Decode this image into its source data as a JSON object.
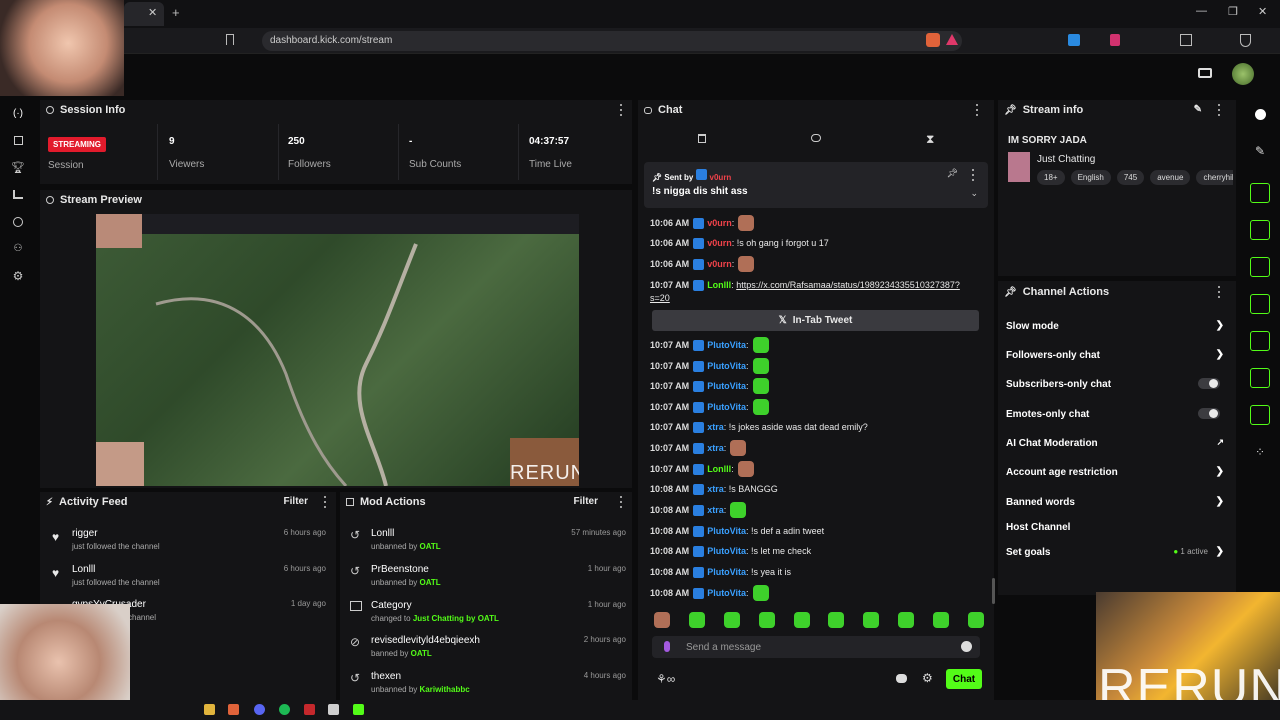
{
  "browser": {
    "url": "dashboard.kick.com/stream"
  },
  "session_info": {
    "title": "Session Info",
    "status": "STREAMING",
    "session_label": "Session",
    "stats": [
      {
        "value": "9",
        "label": "Viewers"
      },
      {
        "value": "250",
        "label": "Followers"
      },
      {
        "value": "-",
        "label": "Sub Counts"
      },
      {
        "value": "04:37:57",
        "label": "Time Live"
      }
    ]
  },
  "stream_preview": {
    "title": "Stream Preview",
    "overlay_text": "RERUN"
  },
  "activity_feed": {
    "title": "Activity Feed",
    "filter": "Filter",
    "items": [
      {
        "name": "rigger",
        "sub": "just followed the channel",
        "time": "6 hours ago"
      },
      {
        "name": "Lonlll",
        "sub": "just followed the channel",
        "time": "6 hours ago"
      },
      {
        "name": "gypsYyCrusader",
        "sub": "channel",
        "time": "1 day ago"
      }
    ]
  },
  "mod_actions": {
    "title": "Mod Actions",
    "filter": "Filter",
    "items": [
      {
        "name": "Lonlll",
        "pre": "unbanned by ",
        "target": "OATL",
        "post": "",
        "time": "57 minutes ago"
      },
      {
        "name": "PrBeenstone",
        "pre": "unbanned by ",
        "target": "OATL",
        "post": "",
        "time": "1 hour ago"
      },
      {
        "name": "Category",
        "pre": "changed to ",
        "target": "Just Chatting",
        "post": " by OATL",
        "time": "1 hour ago"
      },
      {
        "name": "revisedlevityld4ebqieexh",
        "pre": "banned by ",
        "target": "OATL",
        "post": "",
        "time": "2 hours ago"
      },
      {
        "name": "thexen",
        "pre": "unbanned by ",
        "target": "Kariwithabbc",
        "post": "",
        "time": "4 hours ago"
      }
    ]
  },
  "chat": {
    "title": "Chat",
    "pinned_by_label": "Sent by",
    "pinned_user": "v0urn",
    "pinned_message": "!s nigga dis shit ass",
    "tweet_button": "In-Tab Tweet",
    "input_placeholder": "Send a message",
    "send_button": "Chat",
    "messages": [
      {
        "time": "10:06 AM",
        "user": "v0urn",
        "color": "red",
        "text": "",
        "emote": "face"
      },
      {
        "time": "10:06 AM",
        "user": "v0urn",
        "color": "red",
        "text": "!s oh gang i forgot u 17",
        "emote": ""
      },
      {
        "time": "10:06 AM",
        "user": "v0urn",
        "color": "red",
        "text": "",
        "emote": "face"
      },
      {
        "time": "10:07 AM",
        "user": "Lonlll",
        "color": "green",
        "text": "https://x.com/Rafsamaa/status/1989234335510327387?",
        "text2": "s=20",
        "emote": ""
      },
      {
        "time": "10:07 AM",
        "user": "PlutoVita",
        "color": "blue",
        "text": "",
        "emote": "green"
      },
      {
        "time": "10:07 AM",
        "user": "PlutoVita",
        "color": "blue",
        "text": "",
        "emote": "green"
      },
      {
        "time": "10:07 AM",
        "user": "PlutoVita",
        "color": "blue",
        "text": "",
        "emote": "green"
      },
      {
        "time": "10:07 AM",
        "user": "PlutoVita",
        "color": "blue",
        "text": "",
        "emote": "green"
      },
      {
        "time": "10:07 AM",
        "user": "xtra",
        "color": "blue",
        "text": "!s jokes aside was dat dead emily?",
        "emote": ""
      },
      {
        "time": "10:07 AM",
        "user": "xtra",
        "color": "blue",
        "text": "",
        "emote": "face"
      },
      {
        "time": "10:07 AM",
        "user": "Lonlll",
        "color": "green",
        "text": "",
        "emote": "face"
      },
      {
        "time": "10:08 AM",
        "user": "xtra",
        "color": "blue",
        "text": "!s BANGGG",
        "emote": ""
      },
      {
        "time": "10:08 AM",
        "user": "xtra",
        "color": "blue",
        "text": "",
        "emote": "green"
      },
      {
        "time": "10:08 AM",
        "user": "PlutoVita",
        "color": "blue",
        "text": "!s def a adin tweet",
        "emote": ""
      },
      {
        "time": "10:08 AM",
        "user": "PlutoVita",
        "color": "blue",
        "text": "!s let me check",
        "emote": ""
      },
      {
        "time": "10:08 AM",
        "user": "PlutoVita",
        "color": "blue",
        "text": "!s yea it is",
        "emote": ""
      },
      {
        "time": "10:08 AM",
        "user": "PlutoVita",
        "color": "blue",
        "text": "",
        "emote": "green"
      }
    ]
  },
  "stream_info": {
    "title": "Stream info",
    "stream_title": "IM SORRY JADA",
    "category": "Just Chatting",
    "tags": [
      "18+",
      "English",
      "745",
      "avenue",
      "cherryhil"
    ]
  },
  "channel_actions": {
    "title": "Channel Actions",
    "set_goals_status": "1 active",
    "items": [
      {
        "label": "Slow mode",
        "kind": "chevron"
      },
      {
        "label": "Followers-only chat",
        "kind": "chevron"
      },
      {
        "label": "Subscribers-only chat",
        "kind": "toggle"
      },
      {
        "label": "Emotes-only chat",
        "kind": "toggle"
      },
      {
        "label": "AI Chat Moderation",
        "kind": "external"
      },
      {
        "label": "Account age restriction",
        "kind": "chevron"
      },
      {
        "label": "Banned words",
        "kind": "chevron"
      },
      {
        "label": "Host Channel",
        "kind": "none"
      },
      {
        "label": "Set goals",
        "kind": "chevron"
      }
    ]
  },
  "webcam_overlay": {
    "text": "RERUN"
  },
  "colors": {
    "kick_green": "#53fc18",
    "live_red": "#e21b2c",
    "panel": "#141416"
  }
}
